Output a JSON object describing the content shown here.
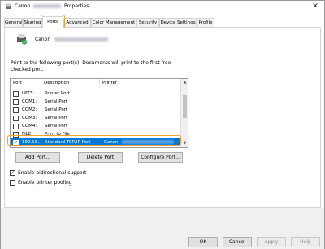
{
  "window": {
    "title_prefix": "Canon",
    "title_suffix": "Properties",
    "close_label": "✕"
  },
  "tabs": [
    {
      "label": "General"
    },
    {
      "label": "Sharing"
    },
    {
      "label": "Ports"
    },
    {
      "label": "Advanced"
    },
    {
      "label": "Color Management"
    },
    {
      "label": "Security"
    },
    {
      "label": "Device Settings"
    },
    {
      "label": "Profile"
    }
  ],
  "active_tab": "Ports",
  "printer": {
    "name_prefix": "Canon"
  },
  "description": "Print to the following port(s). Documents will print to the first free checked port.",
  "port_list": {
    "headers": {
      "port": "Port",
      "description": "Description",
      "printer": "Printer"
    },
    "rows": [
      {
        "port": "LPT3:",
        "description": "Printer Port",
        "printer": "",
        "checked": false
      },
      {
        "port": "COM1:",
        "description": "Serial Port",
        "printer": "",
        "checked": false
      },
      {
        "port": "COM2:",
        "description": "Serial Port",
        "printer": "",
        "checked": false
      },
      {
        "port": "COM3:",
        "description": "Serial Port",
        "printer": "",
        "checked": false
      },
      {
        "port": "COM4:",
        "description": "Serial Port",
        "printer": "",
        "checked": false
      },
      {
        "port": "FILE:",
        "description": "Print to File",
        "printer": "",
        "checked": false
      },
      {
        "port": "192.16...",
        "description": "Standard TCP/IP Port",
        "printer": "Canon",
        "checked": true,
        "selected": true
      }
    ]
  },
  "buttons": {
    "add_port": "Add Port...",
    "delete_port": "Delete Port",
    "configure_port": "Configure Port..."
  },
  "options": {
    "bidirectional": {
      "label": "Enable bidirectional support",
      "checked": true
    },
    "pooling": {
      "label": "Enable printer pooling",
      "checked": false
    }
  },
  "footer": {
    "ok": "OK",
    "cancel": "Cancel",
    "apply": "Apply",
    "help": "Help"
  },
  "colors": {
    "highlight": "#f0a030",
    "selection": "#0078d7"
  }
}
